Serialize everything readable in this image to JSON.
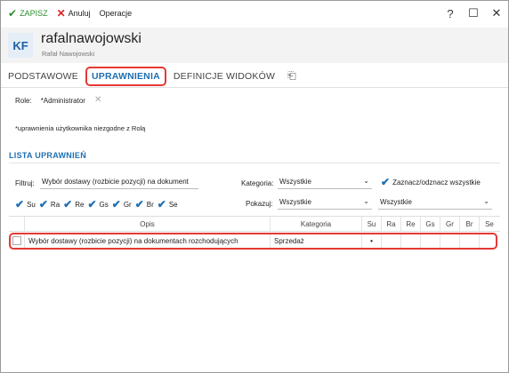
{
  "toolbar": {
    "save_label": "ZAPISZ",
    "cancel_label": "Anuluj",
    "operations_label": "Operacje"
  },
  "window_controls": {
    "help": "?",
    "minimize": "☐",
    "close": "✕"
  },
  "user": {
    "initials": "KF",
    "login": "rafalnawojowski",
    "full_name": "Rafał Nawojowski"
  },
  "tabs": [
    {
      "label": "PODSTAWOWE"
    },
    {
      "label": "UPRAWNIENIA",
      "active": true
    },
    {
      "label": "DEFINICJE WIDOKÓW"
    }
  ],
  "roles": {
    "label": "Role:",
    "value": "*Administrator"
  },
  "note": "*uprawnienia użytkownika niezgodne z Rolą",
  "section_title": "LISTA UPRAWNIEŃ",
  "filters": {
    "filter_label": "Filtruj:",
    "filter_value": "Wybór dostawy (rozbicie pozycji) na dokument",
    "category_label": "Kategoria:",
    "category_value": "Wszystkie",
    "select_all_label": "Zaznacz/odznacz wszystkie",
    "show_label": "Pokazuj:",
    "show_value": "Wszystkie",
    "show_value2": "Wszystkie"
  },
  "column_toggles": [
    "Su",
    "Ra",
    "Re",
    "Gs",
    "Gr",
    "Br",
    "Se"
  ],
  "grid": {
    "headers": {
      "opis": "Opis",
      "kategoria": "Kategoria",
      "perm": [
        "Su",
        "Ra",
        "Re",
        "Gs",
        "Gr",
        "Br",
        "Se"
      ]
    },
    "rows": [
      {
        "opis": "Wybór dostawy (rozbicie pozycji) na dokumentach rozchodujących",
        "kategoria": "Sprzedaż",
        "perm": [
          "•",
          "",
          "",
          "",
          "",
          "",
          ""
        ]
      }
    ]
  }
}
